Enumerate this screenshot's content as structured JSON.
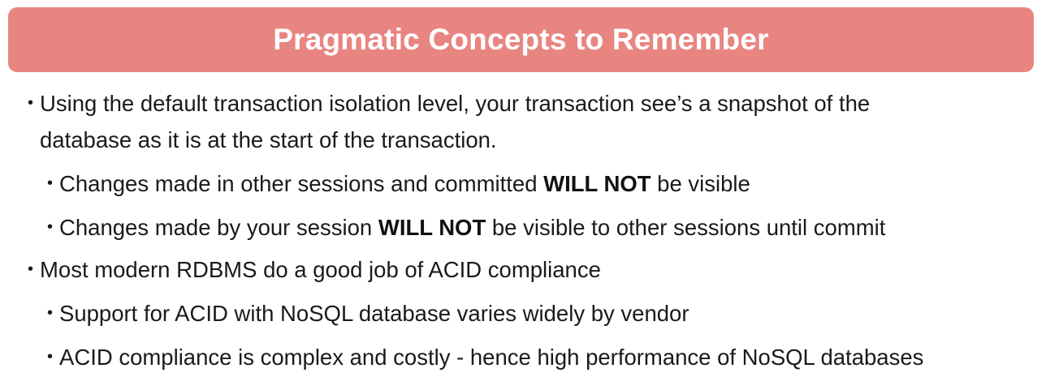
{
  "title": "Pragmatic Concepts to Remember",
  "bullets": [
    {
      "line1": "Using the default transaction isolation level, your transaction see’s a snapshot of the",
      "line2": "database as it is at the start of the transaction."
    },
    {
      "before": "Changes made in other sessions and committed ",
      "bold": "WILL NOT",
      "after": " be visible"
    },
    {
      "before": "Changes made by your session ",
      "bold": "WILL NOT",
      "after": " be visible to other sessions until commit"
    },
    {
      "text": "Most modern RDBMS do a good job of ACID compliance"
    },
    {
      "text": "Support for ACID with NoSQL database varies widely by vendor"
    },
    {
      "text": "ACID compliance is complex and costly - hence high performance of NoSQL databases"
    }
  ],
  "colors": {
    "title_background": "#e98581",
    "title_text": "#ffffff",
    "body_text": "#1a1a1a"
  }
}
